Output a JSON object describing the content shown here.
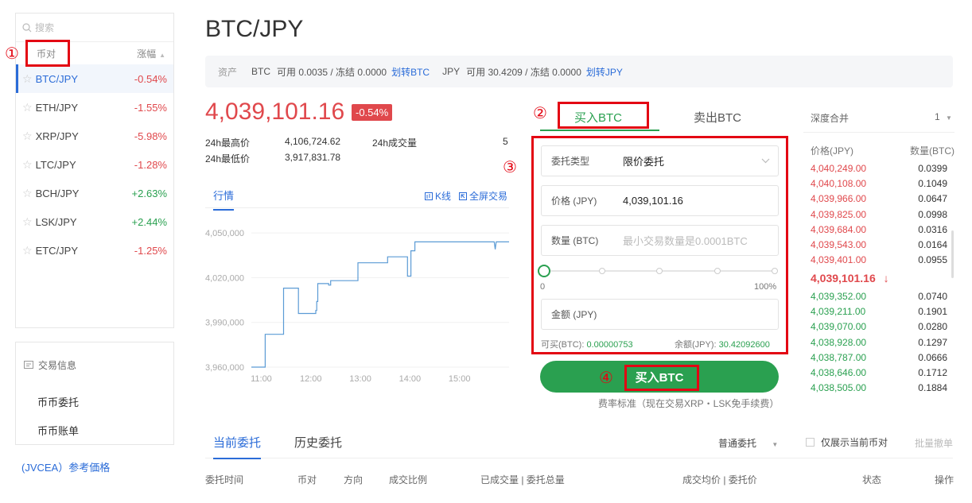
{
  "market": {
    "search_placeholder": "搜索",
    "col_pair": "币对",
    "col_change": "涨幅",
    "rows": [
      {
        "pair": "BTC/JPY",
        "change": "-0.54%",
        "dir": "down"
      },
      {
        "pair": "ETH/JPY",
        "change": "-1.55%",
        "dir": "down"
      },
      {
        "pair": "XRP/JPY",
        "change": "-5.98%",
        "dir": "down"
      },
      {
        "pair": "LTC/JPY",
        "change": "-1.28%",
        "dir": "down"
      },
      {
        "pair": "BCH/JPY",
        "change": "+2.63%",
        "dir": "up"
      },
      {
        "pair": "LSK/JPY",
        "change": "+2.44%",
        "dir": "up"
      },
      {
        "pair": "ETC/JPY",
        "change": "-1.25%",
        "dir": "down"
      }
    ]
  },
  "info": {
    "title": "交易信息",
    "items": [
      "币币委托",
      "币币账单"
    ]
  },
  "jvcea_link": "(JVCEA）参考価格",
  "annotations": [
    "①",
    "②",
    "③",
    "④"
  ],
  "header": {
    "title": "BTC/JPY"
  },
  "assets": {
    "label": "资产",
    "btc_code": "BTC",
    "btc_detail": "可用 0.0035 / 冻结 0.0000",
    "btc_transfer": "划转BTC",
    "jpy_code": "JPY",
    "jpy_detail": "可用 30.4209 / 冻结 0.0000",
    "jpy_transfer": "划转JPY"
  },
  "ticker": {
    "price": "4,039,101.16",
    "change": "-0.54%",
    "high_label": "24h最高价",
    "high": "4,106,724.62",
    "low_label": "24h最低价",
    "low": "3,917,831.78",
    "vol_label": "24h成交量",
    "vol": "5"
  },
  "chart_tabs": {
    "market": "行情",
    "kline": "K线",
    "fullscreen": "全屏交易"
  },
  "chart_data": {
    "type": "line",
    "x_ticks": [
      "11:00",
      "12:00",
      "13:00",
      "14:00",
      "15:00"
    ],
    "y_ticks": [
      "4,050,000",
      "4,020,000",
      "3,990,000",
      "3,960,000"
    ],
    "ylim": [
      3960000,
      4057000
    ],
    "xlim": [
      10.8,
      16.0
    ],
    "points": [
      [
        10.8,
        3960000
      ],
      [
        11.08,
        3960000
      ],
      [
        11.08,
        3982000
      ],
      [
        11.45,
        3982000
      ],
      [
        11.45,
        4013000
      ],
      [
        11.75,
        4013000
      ],
      [
        11.75,
        3996000
      ],
      [
        12.1,
        3996000
      ],
      [
        12.1,
        3998000
      ],
      [
        12.12,
        3998000
      ],
      [
        12.12,
        4004000
      ],
      [
        12.14,
        4004000
      ],
      [
        12.14,
        4016000
      ],
      [
        12.36,
        4016000
      ],
      [
        12.36,
        4015000
      ],
      [
        12.4,
        4015000
      ],
      [
        12.4,
        4018000
      ],
      [
        12.95,
        4018000
      ],
      [
        12.95,
        4030000
      ],
      [
        13.55,
        4030000
      ],
      [
        13.55,
        4034000
      ],
      [
        13.95,
        4034000
      ],
      [
        13.95,
        4021000
      ],
      [
        14.02,
        4021000
      ],
      [
        14.02,
        4038000
      ],
      [
        14.1,
        4038000
      ],
      [
        14.1,
        4044000
      ],
      [
        15.7,
        4044000
      ],
      [
        15.72,
        4039000
      ],
      [
        15.74,
        4044000
      ],
      [
        16.0,
        4044000
      ]
    ],
    "color": "#5b9bd5"
  },
  "order": {
    "buy_tab": "买入BTC",
    "sell_tab": "卖出BTC",
    "type_label": "委托类型",
    "type_value": "限价委托",
    "price_label": "价格 (JPY)",
    "price_value": "4,039,101.16",
    "qty_label": "数量 (BTC)",
    "qty_placeholder": "最小交易数量是0.0001BTC",
    "slider_min": "0",
    "slider_max": "100%",
    "slider_value": 0,
    "amount_label": "金额 (JPY)",
    "avail_label": "可买(BTC):",
    "avail_value": "0.00000753",
    "balance_label": "余额(JPY):",
    "balance_value": "30.42092600",
    "buy_button": "买入BTC",
    "fee_text": "费率标准（现在交易XRP・LSK免手续费）"
  },
  "orderbook": {
    "merge_label": "深度合并",
    "merge_value": "1",
    "price_header": "价格(JPY)",
    "qty_header": "数量(BTC)",
    "asks": [
      {
        "price": "4,040,249.00",
        "qty": "0.0399"
      },
      {
        "price": "4,040,108.00",
        "qty": "0.1049"
      },
      {
        "price": "4,039,966.00",
        "qty": "0.0647"
      },
      {
        "price": "4,039,825.00",
        "qty": "0.0998"
      },
      {
        "price": "4,039,684.00",
        "qty": "0.0316"
      },
      {
        "price": "4,039,543.00",
        "qty": "0.0164"
      },
      {
        "price": "4,039,401.00",
        "qty": "0.0955"
      }
    ],
    "last": "4,039,101.16",
    "last_arrow": "↓",
    "bids": [
      {
        "price": "4,039,352.00",
        "qty": "0.0740"
      },
      {
        "price": "4,039,211.00",
        "qty": "0.1901"
      },
      {
        "price": "4,039,070.00",
        "qty": "0.0280"
      },
      {
        "price": "4,038,928.00",
        "qty": "0.1297"
      },
      {
        "price": "4,038,787.00",
        "qty": "0.0666"
      },
      {
        "price": "4,038,646.00",
        "qty": "0.1712"
      },
      {
        "price": "4,038,505.00",
        "qty": "0.1884"
      }
    ]
  },
  "orders": {
    "tab_current": "当前委托",
    "tab_history": "历史委托",
    "filter_value": "普通委托",
    "only_current": "仅展示当前币对",
    "batch_cancel": "批量撤单",
    "columns": [
      "委托时间",
      "币对",
      "方向",
      "成交比例",
      "已成交量 | 委托总量",
      "成交均价 | 委托价",
      "状态",
      "操作"
    ]
  },
  "colors": {
    "up": "#2aa050",
    "down": "#e0484c",
    "accent": "#2b6cd8",
    "annotation": "#e30613"
  }
}
